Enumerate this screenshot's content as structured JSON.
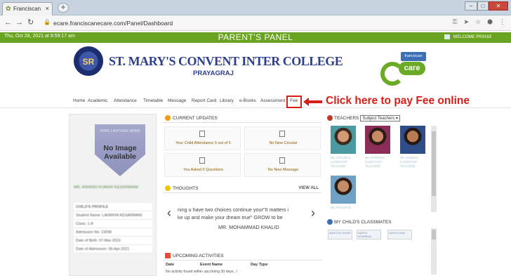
{
  "browser": {
    "tab_title": "Franciscan",
    "url": "ecare.franciscanecare.com/Panel/Dashboard"
  },
  "topbar": {
    "datetime": "Thu, Oct 28, 2021 at 9:59:17 am",
    "panel_title": "PARENT'S PANEL",
    "welcome": "WELCOME PR9163"
  },
  "header": {
    "school_name": "ST. MARY'S CONVENT INTER COLLEGE",
    "city": "PRAYAGRAJ",
    "care_badge": "franciscan",
    "care_word": "care"
  },
  "menu": [
    "Home",
    "Academic",
    "Attendance",
    "Timetable",
    "Message",
    "Report Card",
    "Library",
    "e-Books",
    "Assessment",
    "Fee"
  ],
  "callout": "Click here to pay Fee online",
  "profile": {
    "no_image": "No Image Available",
    "parent_name": "MR. MANISH KUMAR KESARWANI",
    "section_title": "CHILD'S PROFILE",
    "fields": [
      "Student Name: LAVANYA KESARWANI",
      "Class: 1-A",
      "Admission No: 23096",
      "Date of Birth: 07-Mar-2015",
      "Date of Admission: 06-Apr-2021"
    ]
  },
  "current_updates": {
    "title": "CURRENT UPDATES",
    "tiles": [
      "Your Child Attendance 5 out of 5",
      "No New Circular",
      "You Asked 0 Questions",
      "No New Message"
    ]
  },
  "thoughts": {
    "title": "THOUGHTS",
    "view_all": "VIEW ALL",
    "line1": "ning u have two choices continue your\"It matters i",
    "line2": "ke up and make your dream true\"         GROW to be",
    "author": "MR. MOHAMMAD KHALID"
  },
  "upcoming": {
    "title": "UPCOMING ACTIVITIES",
    "columns": [
      "Date",
      "Event Name",
      "Day Type"
    ],
    "empty": "No activity found within upcoming 30 days...!"
  },
  "teachers": {
    "title": "TEACHERS",
    "select": "Subject Teachers",
    "names": [
      "Ms. SHALINI & (ASSISTANT TEACHER)",
      "Ms. KAREENA (ASSISTANT TEACHER)",
      "Ms. SANDHU (ASSISTANT TEACHER)",
      "Ms. PRAGYA B"
    ]
  },
  "classmates": {
    "title": "MY CHILD'S CLASSMATES",
    "names": [
      "AADITYA YADAV",
      "AARYA AGARWAL",
      "AARYA JAIN"
    ]
  }
}
